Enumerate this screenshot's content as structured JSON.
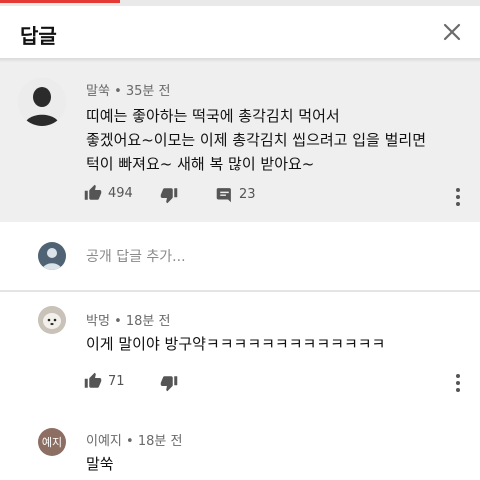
{
  "header": {
    "title": "답글"
  },
  "parent_comment": {
    "author": "말쑥",
    "time": "35분 전",
    "lines": [
      "띠예는 좋아하는 떡국에 총각김치 먹어서",
      "좋겠어요~이모는 이제 총각김치 씹으려고 입을 벌리면",
      "턱이 빠져요~ 새해 복 많이 받아요~"
    ],
    "likes": "494",
    "replies": "23"
  },
  "add_reply": {
    "placeholder": "공개 답글 추가..."
  },
  "replies": [
    {
      "author": "박멍",
      "time": "18분 전",
      "text": "이게 말이야 방구약ㅋㅋㅋㅋㅋㅋㅋㅋㅋㅋㅋㅋㅋ",
      "likes": "71"
    },
    {
      "author": "이예지",
      "time": "18분 전",
      "text": "말쑥",
      "avatar_text": "예지"
    }
  ],
  "colors": {
    "parent_bg": "#efefef",
    "reply2_avatar": "#8d6e63",
    "accent_red": "#e53935"
  }
}
